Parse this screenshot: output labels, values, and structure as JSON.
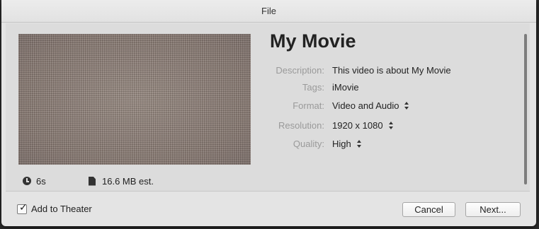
{
  "window": {
    "title": "File"
  },
  "movie": {
    "title": "My Movie"
  },
  "thumbnail": {
    "description": ""
  },
  "meta": {
    "duration": "6s",
    "size": "16.6 MB est."
  },
  "fields": {
    "description": {
      "label": "Description:",
      "value": "This video is about My Movie"
    },
    "tags": {
      "label": "Tags:",
      "value": "iMovie"
    },
    "format": {
      "label": "Format:",
      "value": "Video and Audio"
    },
    "resolution": {
      "label": "Resolution:",
      "value": "1920 x 1080"
    },
    "quality": {
      "label": "Quality:",
      "value": "High"
    }
  },
  "footer": {
    "add_to_theater": {
      "label": "Add to Theater",
      "checked": true
    },
    "cancel_label": "Cancel",
    "next_label": "Next..."
  },
  "icons": {
    "duration": "clock-icon",
    "size": "document-icon",
    "popup": "up-down-arrows-icon"
  }
}
